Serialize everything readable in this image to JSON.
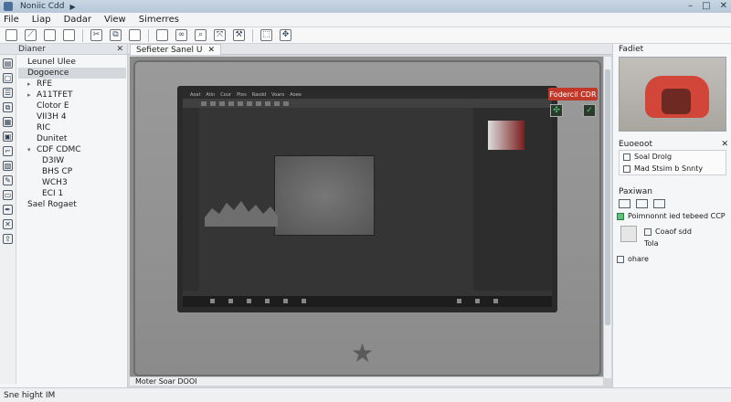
{
  "window": {
    "title": "Noniic Cdd",
    "controls": [
      "–",
      "□",
      "✕"
    ]
  },
  "menu": [
    "File",
    "Liap",
    "Dadar",
    "View",
    "Simerres"
  ],
  "toolbar": [
    {
      "icon": "new-file-icon",
      "glyph": ""
    },
    {
      "icon": "edit-icon",
      "glyph": "⟋"
    },
    {
      "icon": "open-icon",
      "glyph": ""
    },
    {
      "icon": "save-icon",
      "glyph": ""
    },
    {
      "icon": "sep"
    },
    {
      "icon": "cut-icon",
      "glyph": "✂"
    },
    {
      "icon": "copy-icon",
      "glyph": "⧉"
    },
    {
      "icon": "paste-icon",
      "glyph": ""
    },
    {
      "icon": "sep"
    },
    {
      "icon": "frame-icon",
      "glyph": ""
    },
    {
      "icon": "link-icon",
      "glyph": "∞"
    },
    {
      "icon": "zoom-icon",
      "glyph": "⌕"
    },
    {
      "icon": "transform-icon",
      "glyph": "⤧"
    },
    {
      "icon": "tool-icon",
      "glyph": "⚒"
    },
    {
      "icon": "sep"
    },
    {
      "icon": "select-icon",
      "glyph": "⬚"
    },
    {
      "icon": "move-icon",
      "glyph": "✥"
    }
  ],
  "leftpanel": {
    "header": "Dianer",
    "close": "✕",
    "tree": [
      {
        "label": "Leunel Ulee",
        "indent": 0,
        "expander": "",
        "selected": false
      },
      {
        "label": "Dogoence",
        "indent": 0,
        "expander": "",
        "selected": true
      },
      {
        "label": "RFE",
        "indent": 1,
        "expander": "▸",
        "selected": false
      },
      {
        "label": "A11TFET",
        "indent": 1,
        "expander": "▸",
        "selected": false
      },
      {
        "label": "Clotor E",
        "indent": 1,
        "expander": "",
        "selected": false
      },
      {
        "label": "VII3H 4",
        "indent": 1,
        "expander": "",
        "selected": false
      },
      {
        "label": "RIC",
        "indent": 1,
        "expander": "",
        "selected": false
      },
      {
        "label": "Dunitet",
        "indent": 1,
        "expander": "",
        "selected": false
      },
      {
        "label": "CDF CDMC",
        "indent": 1,
        "expander": "▾",
        "selected": false
      },
      {
        "label": "D3IW",
        "indent": 2,
        "expander": "",
        "selected": false
      },
      {
        "label": "BHS CP",
        "indent": 2,
        "expander": "",
        "selected": false
      },
      {
        "label": "WCH3",
        "indent": 2,
        "expander": "",
        "selected": false
      },
      {
        "label": "ECI 1",
        "indent": 2,
        "expander": "",
        "selected": false
      },
      {
        "label": "Sael Rogaet",
        "indent": 0,
        "expander": "",
        "selected": false
      }
    ],
    "side_icons": [
      "layer-icon",
      "page-icon",
      "list-icon",
      "copy-icon",
      "stack-icon",
      "folder-icon",
      "hook-icon",
      "image-icon",
      "brush-icon",
      "eraser-icon",
      "pen-icon",
      "close-icon",
      "share-icon"
    ]
  },
  "document": {
    "tab_label": "Sefieter Sanel U",
    "tab_close": "✕",
    "badge": "Fodercil CDR",
    "screen_menu": [
      "Aoat",
      "Atin",
      "Cour",
      "Ptes",
      "Rasdd",
      "Voaro",
      "Aoee"
    ],
    "status_label": "Moter Soar DOOI"
  },
  "rightpanel": {
    "preview_title": "Fadiet",
    "section1_title": "Euoeoot",
    "section1_close": "✕",
    "section1_lines": [
      "Soal Drolg",
      "Mad Stsim b Snnty"
    ],
    "section2_title": "Paxiwan",
    "section2_line": "Poimnonnt ied tebeed CCP",
    "option1": "Coaof sdd",
    "option2": "Tola",
    "option3": "ohare"
  },
  "statusbar": {
    "text": "Sne hight IM"
  }
}
